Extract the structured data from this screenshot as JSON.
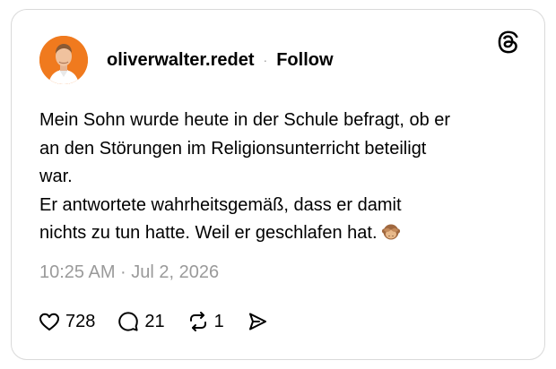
{
  "post": {
    "username": "oliverwalter.redet",
    "separator": "·",
    "follow_label": "Follow",
    "avatar_bg": "#f07a1e",
    "logo_icon": "threads-logo-icon",
    "text_lines": [
      "Mein Sohn wurde heute in der Schule befragt, ob er",
      "an den Störungen im Religionsunterricht beteiligt",
      "war.",
      "Er antwortete wahrheitsgemäß, dass er damit",
      "nichts zu tun hatte. Weil er geschlafen hat."
    ],
    "emoji_icon": "see-no-evil-monkey-emoji",
    "timestamp": "10:25 AM · Jul 2, 2026"
  },
  "actions": {
    "likes": {
      "icon": "heart-icon",
      "count": "728"
    },
    "replies": {
      "icon": "comment-icon",
      "count": "21"
    },
    "reposts": {
      "icon": "repost-icon",
      "count": "1"
    },
    "share": {
      "icon": "share-icon"
    }
  }
}
